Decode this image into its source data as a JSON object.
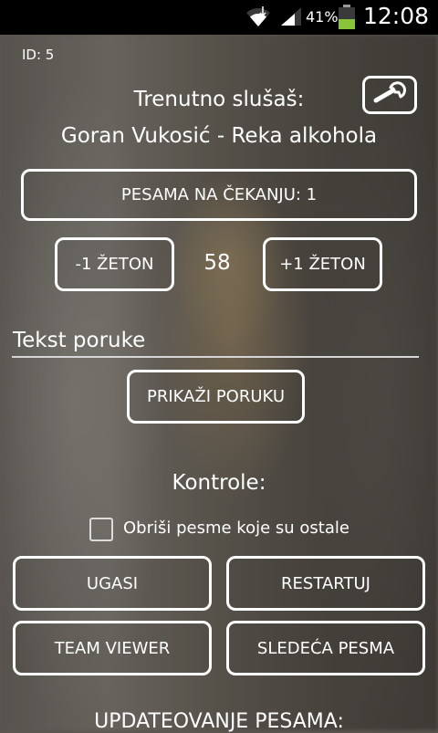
{
  "status_bar": {
    "battery_percent": "41%",
    "time": "12:08",
    "icons": [
      "wifi-icon",
      "signal-icon",
      "battery-icon"
    ]
  },
  "header": {
    "id_label": "ID: 5",
    "settings_icon": "wrench-icon"
  },
  "now_playing": {
    "label": "Trenutno slušaš:",
    "song": "Goran Vukosić - Reka alkohola"
  },
  "queue": {
    "label": "PESAMA NA ČEKANJU: 1"
  },
  "tokens": {
    "minus_label": "-1 ŽETON",
    "count": "58",
    "plus_label": "+1 ŽETON"
  },
  "message": {
    "placeholder": "Tekst poruke",
    "show_label": "PRIKAŽI PORUKU"
  },
  "controls": {
    "title": "Kontrole:",
    "checkbox_label": "Obriši pesme koje su ostale",
    "checkbox_checked": false,
    "off_label": "UGASI",
    "restart_label": "RESTARTUJ",
    "teamviewer_label": "TEAM VIEWER",
    "next_label": "SLEDEĆA PESMA"
  },
  "footer": {
    "update_label": "UPDATEOVANJE PESAMA:"
  }
}
